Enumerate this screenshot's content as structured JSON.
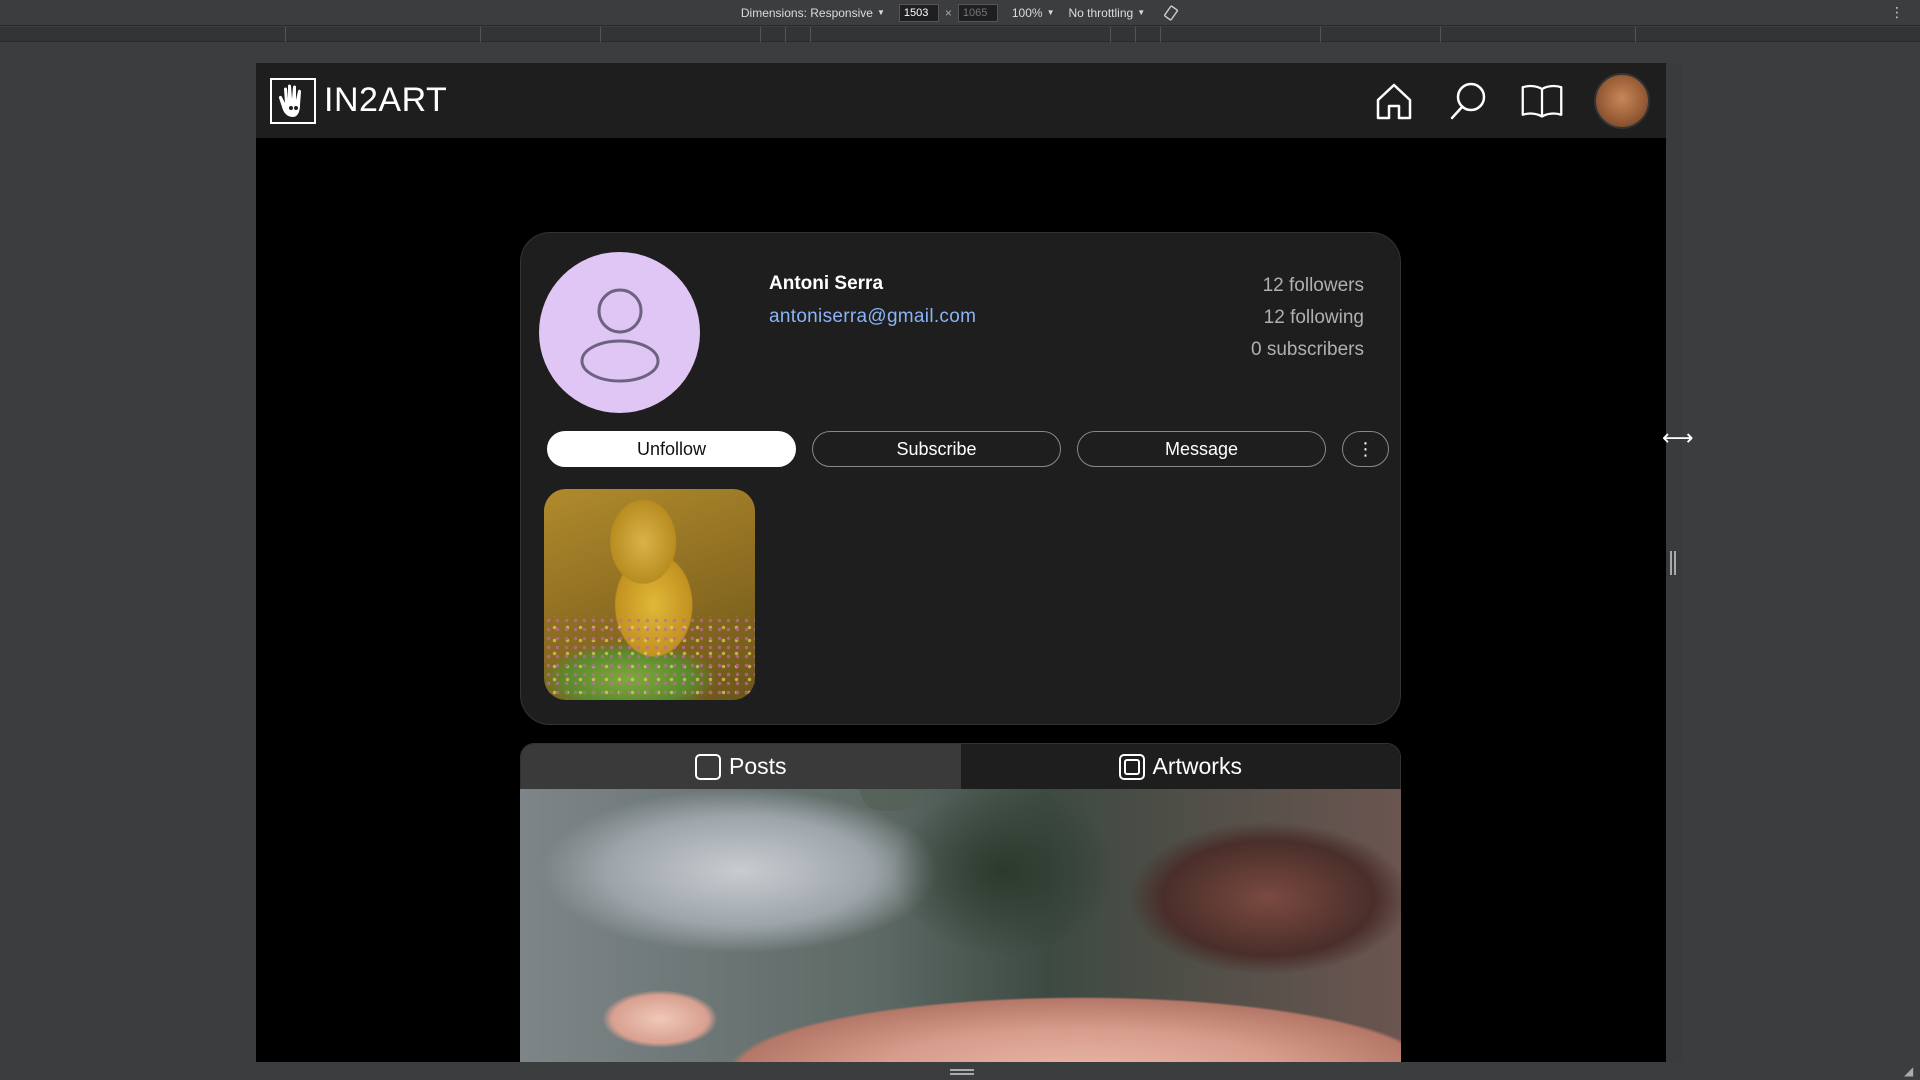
{
  "devtools": {
    "dimensions_label": "Dimensions: Responsive",
    "width_value": "1503",
    "height_value": "1065",
    "times": "×",
    "zoom_label": "100%",
    "throttling_label": "No throttling"
  },
  "app": {
    "logo_text": "IN2ART",
    "nav": {
      "home": "home-icon",
      "search": "search-icon",
      "library": "book-icon",
      "profile": "avatar"
    }
  },
  "profile": {
    "name": "Antoni Serra",
    "email": "antoniserra@gmail.com",
    "stats": {
      "followers": "12 followers",
      "following": "12 following",
      "subscribers": "0 subscribers"
    },
    "actions": {
      "unfollow": "Unfollow",
      "subscribe": "Subscribe",
      "message": "Message",
      "more": "⋮"
    }
  },
  "tabs": [
    {
      "label": "Posts",
      "active": true
    },
    {
      "label": "Artworks",
      "active": false
    }
  ],
  "colors": {
    "accent_link": "#8ab4f8",
    "avatar_bg": "#e0c6f4",
    "header_bg": "#1e1e1e",
    "page_bg": "#000000"
  }
}
